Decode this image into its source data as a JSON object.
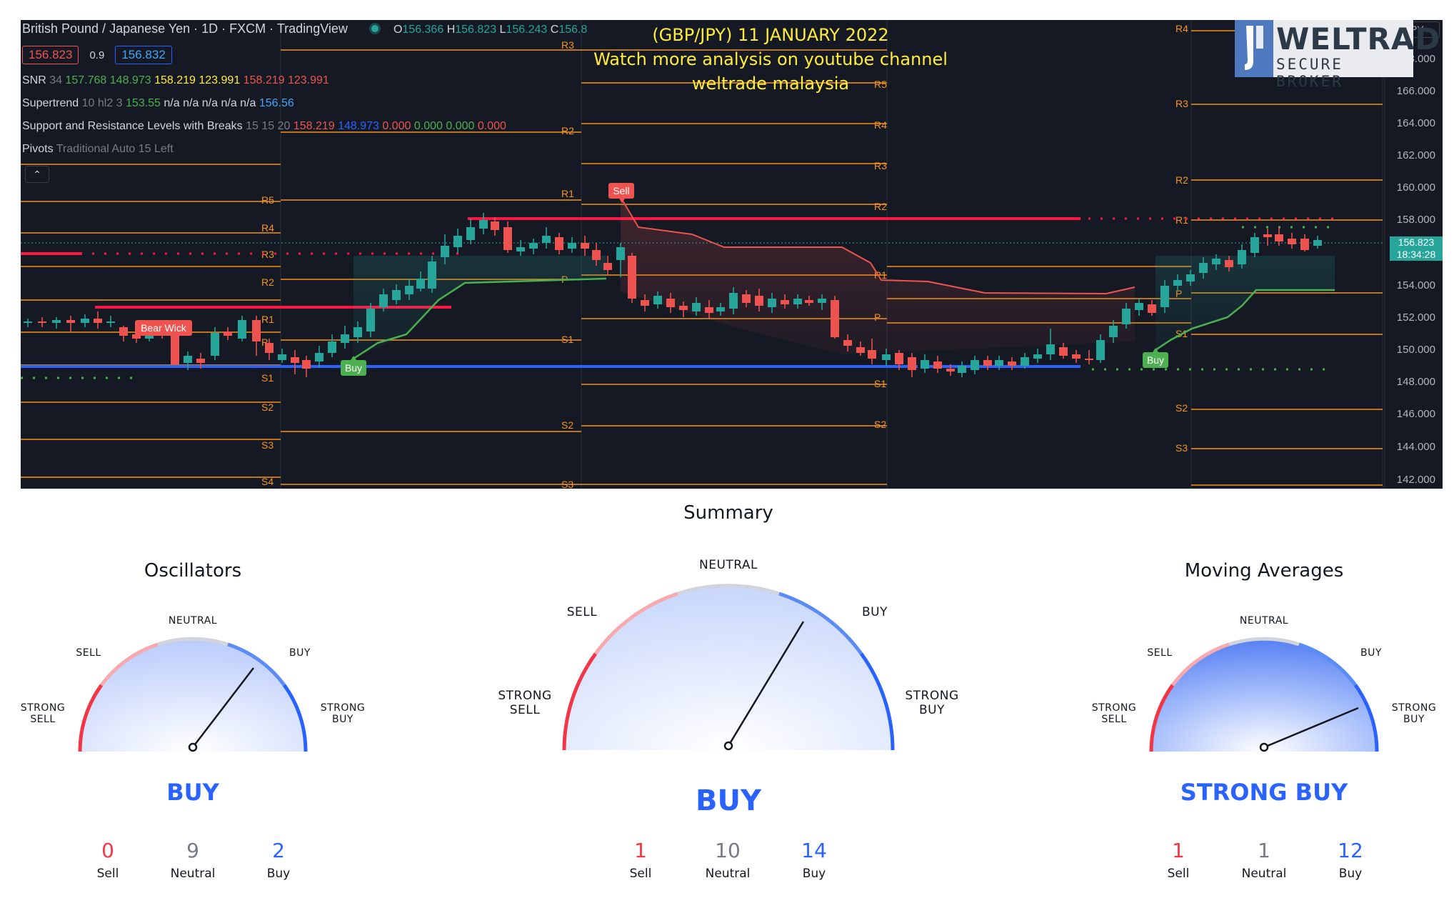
{
  "chart": {
    "symbol_line": "British Pound / Japanese Yen · 1D · FXCM · TradingView",
    "ohlc": {
      "o_label": "O",
      "o": "156.366",
      "h_label": "H",
      "h": "156.823",
      "l_label": "L",
      "l": "156.243",
      "c_label": "C",
      "c": "156.8"
    },
    "bid": "156.823",
    "spread": "0.9",
    "ask": "156.832",
    "indicators": {
      "snr": {
        "name": "SNR",
        "params": "34",
        "v1": "157.768",
        "v2": "148.973",
        "v3": "158.219",
        "v4": "123.991",
        "v5": "158.219",
        "v6": "123.991"
      },
      "supertrend": {
        "name": "Supertrend",
        "params": "10 hl2 3",
        "v1": "153.55",
        "v2": "n/a n/a n/a n/a n/a",
        "v3": "156.56"
      },
      "srb": {
        "name": "Support and Resistance Levels with Breaks",
        "params": "15 15 20",
        "v1": "158.219",
        "v2": "148.973",
        "v3": "0.000",
        "v4": "0.000",
        "v5": "0.000",
        "v6": "0.000"
      },
      "pivots": {
        "name": "Pivots",
        "params": "Traditional Auto 15 Left"
      }
    },
    "overlay_lines": [
      "(GBP/JPY) 11 JANUARY 2022",
      "Watch more analysis on youtube channel",
      "weltrade malaysia"
    ],
    "currency_button": "JPY",
    "price_axis": [
      "168.000",
      "166.000",
      "164.000",
      "162.000",
      "160.000",
      "158.000",
      "154.000",
      "152.000",
      "150.000",
      "148.000",
      "146.000",
      "144.000",
      "142.000"
    ],
    "current_price": "156.823",
    "countdown": "18:34:28",
    "signals": {
      "sell": "Sell",
      "buy": "Buy",
      "bear_wick": "Bear Wick"
    },
    "colors": {
      "background": "#151924",
      "up": "#26a69a",
      "down": "#ef5350",
      "pivot": "#f7931a",
      "resistance": "#ff1744",
      "support": "#2962ff"
    }
  },
  "logo": {
    "word": "WELTRADE",
    "tagline": "SECURE BROKER"
  },
  "summary": {
    "title": "Summary",
    "labels": {
      "strong_sell": "STRONG SELL",
      "sell": "SELL",
      "neutral": "NEUTRAL",
      "buy": "BUY",
      "strong_buy": "STRONG BUY"
    },
    "verdict": "BUY",
    "counts": {
      "sell": "1",
      "neutral": "10",
      "buy": "14"
    }
  },
  "oscillators": {
    "title": "Oscillators",
    "labels": {
      "strong_sell": "STRONG SELL",
      "sell": "SELL",
      "neutral": "NEUTRAL",
      "buy": "BUY",
      "strong_buy": "STRONG BUY"
    },
    "verdict": "BUY",
    "counts": {
      "sell": "0",
      "neutral": "9",
      "buy": "2"
    }
  },
  "moving_averages": {
    "title": "Moving Averages",
    "labels": {
      "strong_sell": "STRONG SELL",
      "sell": "SELL",
      "neutral": "NEUTRAL",
      "buy": "BUY",
      "strong_buy": "STRONG BUY"
    },
    "verdict": "STRONG BUY",
    "counts": {
      "sell": "1",
      "neutral": "1",
      "buy": "12"
    }
  },
  "count_labels": {
    "sell": "Sell",
    "neutral": "Neutral",
    "buy": "Buy"
  }
}
